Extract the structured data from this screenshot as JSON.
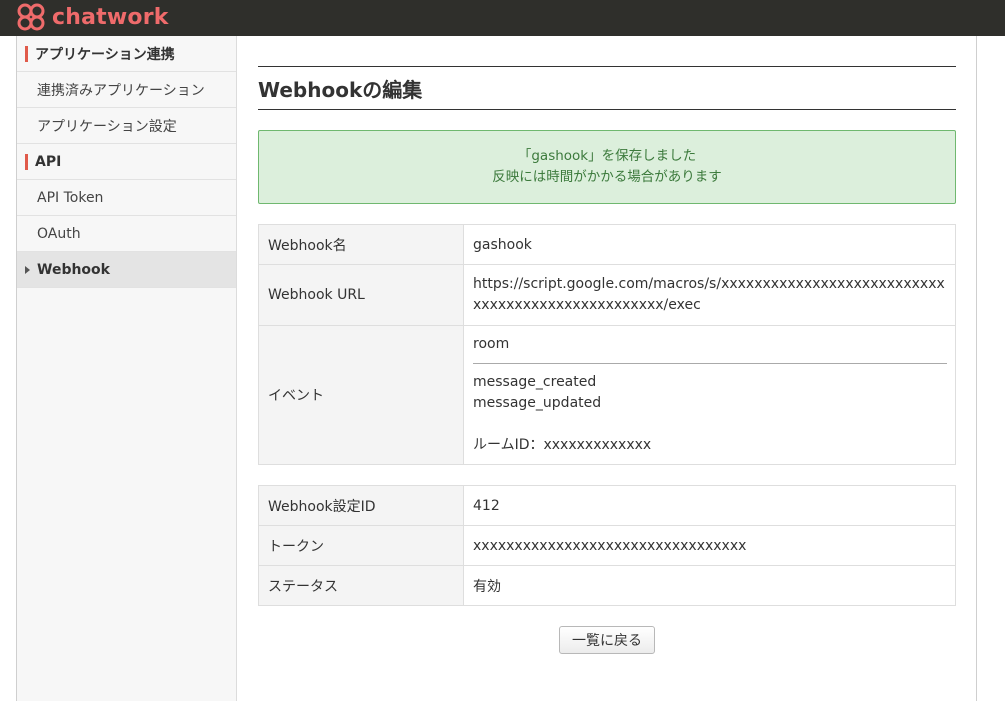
{
  "header": {
    "logo_text": "chatwork",
    "logo_icon": "chatwork-logo-icon"
  },
  "sidebar": {
    "sections": [
      {
        "title": "アプリケーション連携",
        "items": [
          "連携済みアプリケーション",
          "アプリケーション設定"
        ]
      },
      {
        "title": "API",
        "items": [
          "API Token",
          "OAuth",
          "Webhook"
        ]
      }
    ],
    "active_item": "Webhook"
  },
  "main": {
    "title": "Webhookの編集",
    "notice": {
      "line1": "「gashook」を保存しました",
      "line2": "反映には時間がかかる場合があります"
    },
    "details": {
      "name_label": "Webhook名",
      "name_value": "gashook",
      "url_label": "Webhook URL",
      "url_value": "https://script.google.com/macros/s/xxxxxxxxxxxxxxxxxxxxxxxxxxxxxxxxxxxxxxxxxxxxxxxxxx/exec",
      "event_label": "イベント",
      "event_group": "room",
      "events": [
        "message_created",
        "message_updated"
      ],
      "room_id": "ルームID：xxxxxxxxxxxxx"
    },
    "info": {
      "id_label": "Webhook設定ID",
      "id_value": "412",
      "token_label": "トークン",
      "token_value": "xxxxxxxxxxxxxxxxxxxxxxxxxxxxxxxxx",
      "status_label": "ステータス",
      "status_value": "有効"
    },
    "back_button": "一覧に戻る"
  },
  "colors": {
    "topbar": "#2f2f2b",
    "brand": "#ef6b6b",
    "accent_bar": "#e05a4a",
    "notice_bg": "#dcefdc",
    "notice_text": "#3c7a3c"
  }
}
